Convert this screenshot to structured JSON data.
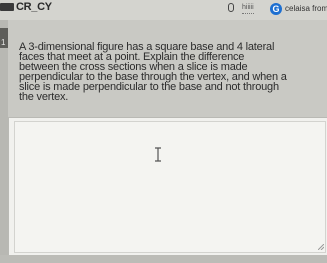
{
  "topbar": {
    "course_tag": "CR_CY",
    "mic_icon": "microphone-icon",
    "handle": "hiiiii",
    "g_letter": "G",
    "account": "celaisa from"
  },
  "sidebar": {
    "question_number": "1"
  },
  "question": {
    "lines": [
      "A 3-dimensional figure has a square base and 4 lateral",
      "faces that meet at a point. Explain the difference",
      "between the cross sections when a slice is made",
      "perpendicular to the base through the vertex, and when a",
      "slice is made perpendicular to the base and not through",
      "the vertex."
    ]
  },
  "answer": {
    "value": "",
    "cursor_icon": "text-cursor-icon"
  },
  "colors": {
    "background": "#c9c9c4",
    "answer_bg": "#f1f1ee",
    "brand_blue": "#1d6fd1"
  }
}
